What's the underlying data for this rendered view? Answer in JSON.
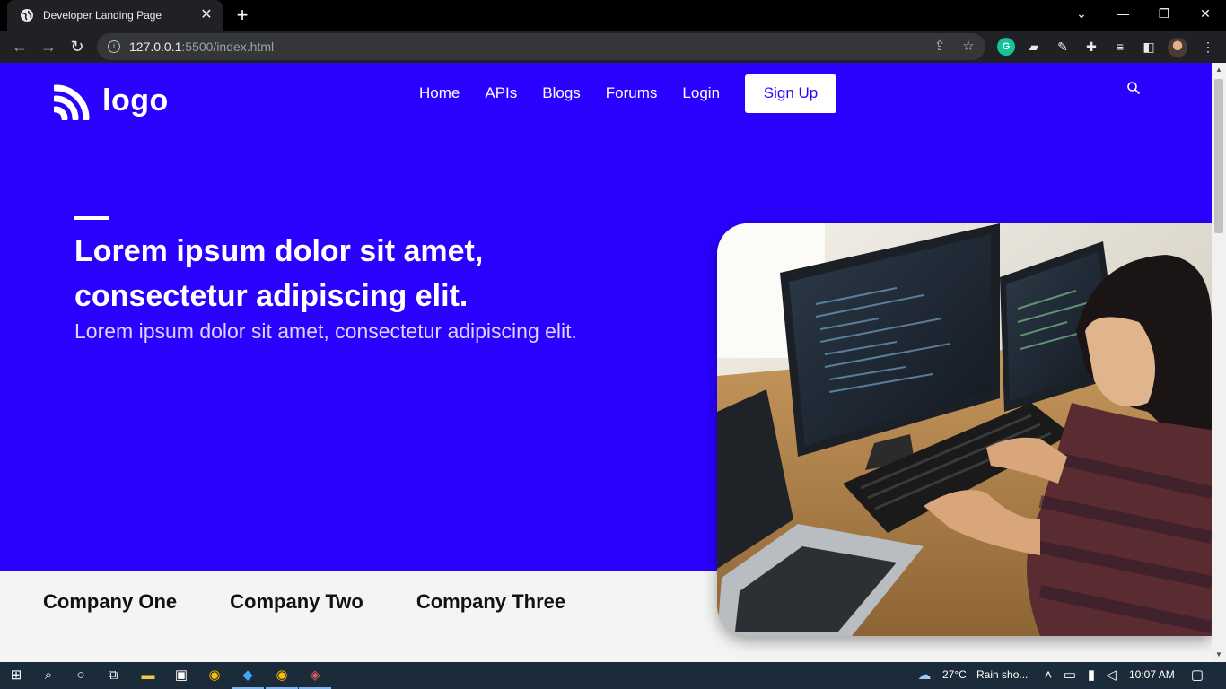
{
  "browser": {
    "tab_title": "Developer Landing Page",
    "url_host": "127.0.0.1",
    "url_path": ":5500/index.html"
  },
  "page": {
    "logo_text": "logo",
    "nav": [
      "Home",
      "APIs",
      "Blogs",
      "Forums",
      "Login"
    ],
    "signup_label": "Sign Up",
    "headline_line1": "Lorem ipsum dolor sit amet,",
    "headline_line2": "consectetur adipiscing elit.",
    "subheadline": "Lorem ipsum dolor sit amet, consectetur adipiscing elit.",
    "companies": [
      "Company One",
      "Company Two",
      "Company Three"
    ],
    "colors": {
      "brand": "#2a00ff",
      "section_bg": "#f4f4f4"
    }
  },
  "taskbar": {
    "weather": "27°C",
    "weather_desc": "Rain sho...",
    "time": "10:07 AM"
  }
}
